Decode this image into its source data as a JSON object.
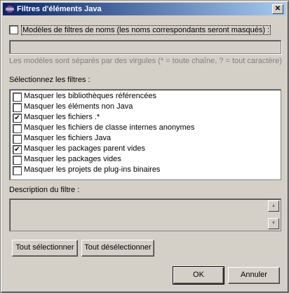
{
  "window": {
    "title": "Filtres d'éléments Java",
    "close_glyph": "✕"
  },
  "patterns": {
    "checkbox_label": "Modèles de filtres de noms (les noms correspondants seront masqués) :",
    "checked": false,
    "input_value": "",
    "hint": "Les modèles sont séparés par des virgules (* = toute chaîne, ? = tout caractère)"
  },
  "filters": {
    "heading": "Sélectionnez les filtres :",
    "items": [
      {
        "label": "Masquer les bibliothèques référencées",
        "checked": false,
        "mark": ""
      },
      {
        "label": "Masquer les éléments non Java",
        "checked": false,
        "mark": ""
      },
      {
        "label": "Masquer les fichiers .*",
        "checked": true,
        "mark": "✔"
      },
      {
        "label": "Masquer les fichiers de classe internes anonymes",
        "checked": false,
        "mark": ""
      },
      {
        "label": "Masquer les fichiers Java",
        "checked": false,
        "mark": ""
      },
      {
        "label": "Masquer les packages parent vides",
        "checked": true,
        "mark": "✔"
      },
      {
        "label": "Masquer les packages vides",
        "checked": false,
        "mark": ""
      },
      {
        "label": "Masquer les projets de plug-ins binaires",
        "checked": false,
        "mark": ""
      }
    ]
  },
  "description": {
    "heading": "Description du filtre :",
    "text": ""
  },
  "buttons": {
    "select_all": "Tout sélectionner",
    "deselect_all": "Tout désélectionner",
    "ok": "OK",
    "cancel": "Annuler"
  },
  "icons": {
    "app": "eclipse-icon",
    "scroll_up": "▲",
    "scroll_down": "▼"
  },
  "colors": {
    "title_start": "#0a246a",
    "title_end": "#a6caf0",
    "face": "#d4d0c8"
  }
}
